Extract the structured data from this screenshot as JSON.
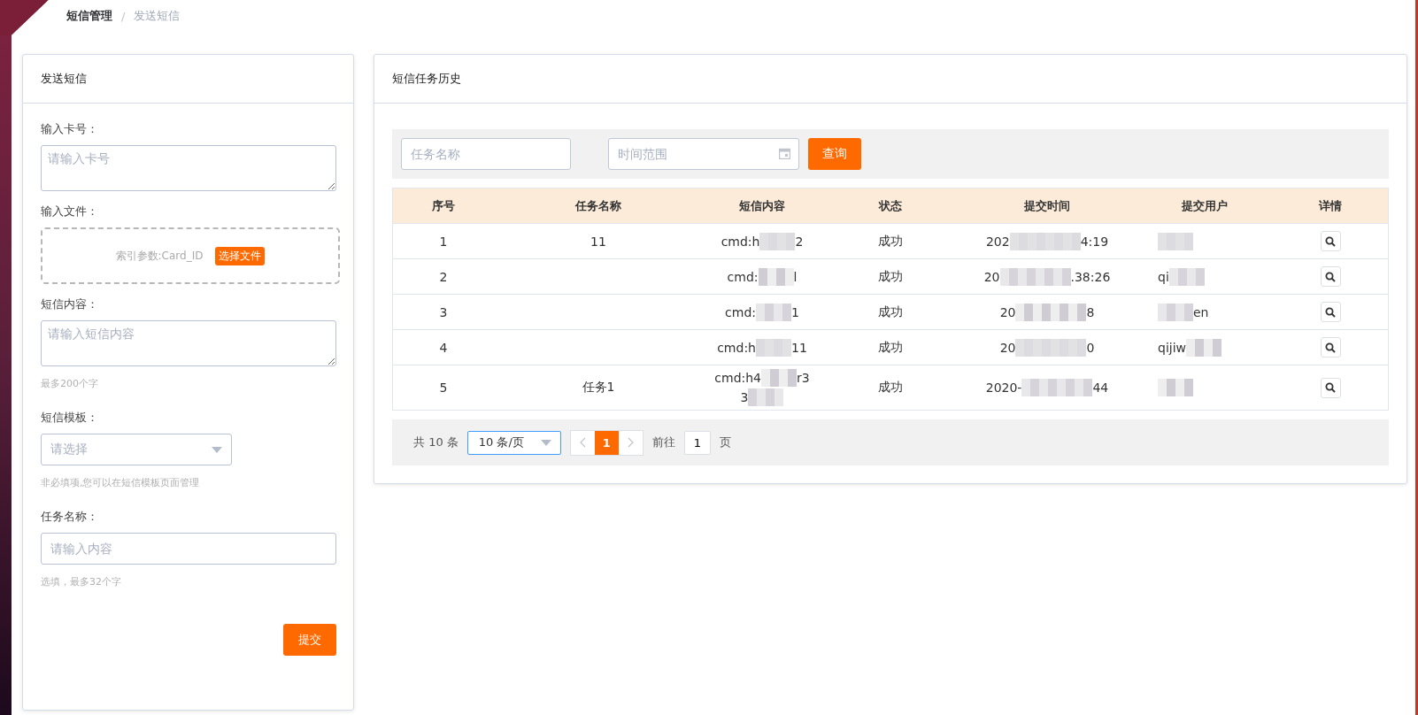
{
  "breadcrumb": {
    "separator": "/",
    "items": [
      {
        "label": "短信管理",
        "current": false
      },
      {
        "label": "发送短信",
        "current": true
      }
    ]
  },
  "send_panel": {
    "title": "发送短信",
    "fields": [
      {
        "kind": "textarea",
        "label": "输入卡号：",
        "placeholder": "请输入卡号"
      },
      {
        "kind": "file",
        "label": "输入文件：",
        "hint": "索引参数:Card_ID",
        "button": "选择文件"
      },
      {
        "kind": "textarea",
        "label": "短信内容：",
        "placeholder": "请输入短信内容",
        "help": "最多200个字"
      },
      {
        "kind": "select",
        "label": "短信模板：",
        "placeholder": "请选择",
        "help": "非必填项,您可以在短信模板页面管理"
      },
      {
        "kind": "input",
        "label": "任务名称：",
        "placeholder": "请输入内容",
        "help": "选填，最多32个字"
      }
    ],
    "submit": "提交"
  },
  "history_panel": {
    "title": "短信任务历史",
    "filters": {
      "name_placeholder": "任务名称",
      "time_placeholder": "时间范围",
      "query_button": "查询"
    },
    "table": {
      "columns": [
        "序号",
        "任务名称",
        "短信内容",
        "状态",
        "提交时间",
        "提交用户",
        "详情"
      ],
      "rows": [
        {
          "index": "1",
          "task_name": "11",
          "content": [
            [
              {
                "kind": "text",
                "text": "cmd:h"
              },
              {
                "kind": "masked"
              },
              {
                "kind": "text",
                "text": "2"
              }
            ]
          ],
          "status": "成功",
          "time": [
            {
              "kind": "text",
              "text": "202"
            },
            {
              "kind": "masked"
            },
            {
              "kind": "text",
              "text": "4:19"
            }
          ],
          "user": [
            {
              "kind": "masked"
            }
          ]
        },
        {
          "index": "2",
          "content": [
            [
              {
                "kind": "text",
                "text": "cmd:"
              },
              {
                "kind": "masked"
              },
              {
                "kind": "text",
                "text": "l"
              }
            ]
          ],
          "status": "成功",
          "time": [
            {
              "kind": "text",
              "text": "20"
            },
            {
              "kind": "masked"
            },
            {
              "kind": "text",
              "text": ".38:26"
            }
          ],
          "user": [
            {
              "kind": "text",
              "text": "qi"
            },
            {
              "kind": "masked"
            }
          ]
        },
        {
          "index": "3",
          "content": [
            [
              {
                "kind": "text",
                "text": "cmd:"
              },
              {
                "kind": "masked"
              },
              {
                "kind": "text",
                "text": "1"
              }
            ]
          ],
          "status": "成功",
          "time": [
            {
              "kind": "text",
              "text": "20"
            },
            {
              "kind": "masked"
            },
            {
              "kind": "text",
              "text": "8"
            }
          ],
          "user": [
            {
              "kind": "masked"
            },
            {
              "kind": "text",
              "text": "en"
            }
          ]
        },
        {
          "index": "4",
          "content": [
            [
              {
                "kind": "text",
                "text": "cmd:h"
              },
              {
                "kind": "masked"
              },
              {
                "kind": "text",
                "text": "11"
              }
            ]
          ],
          "status": "成功",
          "time": [
            {
              "kind": "text",
              "text": "20"
            },
            {
              "kind": "masked"
            },
            {
              "kind": "text",
              "text": "0"
            }
          ],
          "user": [
            {
              "kind": "text",
              "text": "qijiw"
            },
            {
              "kind": "masked"
            }
          ]
        },
        {
          "index": "5",
          "task_name": "任务1",
          "content": [
            [
              {
                "kind": "text",
                "text": "cmd:h4"
              },
              {
                "kind": "masked"
              },
              {
                "kind": "text",
                "text": "r3"
              }
            ],
            [
              {
                "kind": "text",
                "text": "3"
              },
              {
                "kind": "masked"
              }
            ]
          ],
          "status": "成功",
          "time": [
            {
              "kind": "text",
              "text": "2020-"
            },
            {
              "kind": "masked"
            },
            {
              "kind": "text",
              "text": "44"
            }
          ],
          "user": [
            {
              "kind": "masked"
            }
          ]
        }
      ]
    },
    "pagination": {
      "total": "共 10 条",
      "page_size": "10 条/页",
      "pages": [
        {
          "label": "1",
          "selected": true
        }
      ],
      "goto_label": "前往",
      "goto_value": "1",
      "page_suffix": "页"
    }
  }
}
